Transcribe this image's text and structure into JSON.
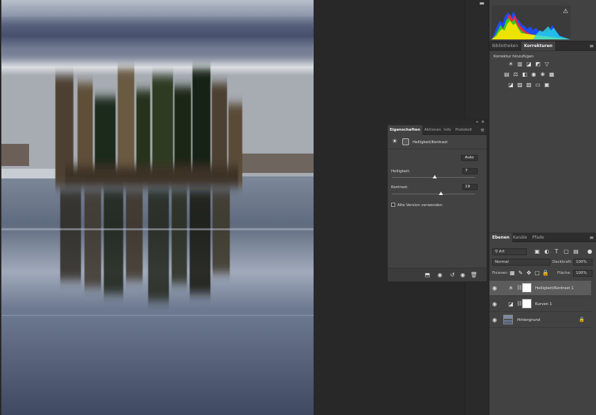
{
  "colors": {
    "accent": "#5c5c5c",
    "panel": "#424242",
    "tab_dark": "#2d2d2d"
  },
  "histogram": {
    "warning_icon": "warning-triangle-icon"
  },
  "korrekturen_panel": {
    "tabs": [
      "Bibliotheken",
      "Korrekturen"
    ],
    "active_tab": "Korrekturen",
    "title": "Korrektur hinzufügen",
    "icons": [
      [
        "brightness-icon",
        "levels-icon",
        "curves-icon",
        "exposure-icon",
        "vibrance-icon"
      ],
      [
        "hue-saturation-icon",
        "color-balance-icon",
        "black-white-icon",
        "photo-filter-icon",
        "channel-mixer-icon",
        "color-lookup-icon"
      ],
      [
        "invert-icon",
        "posterize-icon",
        "threshold-icon",
        "gradient-map-icon",
        "selective-color-icon"
      ]
    ]
  },
  "properties_panel": {
    "tabs": [
      "Eigenschaften",
      "Aktionen",
      "Info",
      "Protokoll"
    ],
    "active_tab": "Eigenschaften",
    "adjustment_name": "Helligkeit/Kontrast",
    "auto_label": "Auto",
    "brightness_label": "Helligkeit:",
    "brightness_value": "7",
    "brightness_fraction": 0.52,
    "contrast_label": "Kontrast:",
    "contrast_value": "19",
    "contrast_fraction": 0.59,
    "legacy_label": "Alte Version verwenden"
  },
  "layers_panel": {
    "tabs": [
      "Ebenen",
      "Kanäle",
      "Pfade"
    ],
    "active_tab": "Ebenen",
    "filter_value": "Art",
    "blend_mode": "Normal",
    "opacity_label": "Deckkraft:",
    "opacity_value": "100%",
    "lock_label": "Fixieren:",
    "fill_label": "Fläche:",
    "fill_value": "100%",
    "layers": [
      {
        "name": "Helligkeit/Kontrast 1",
        "selected": true
      },
      {
        "name": "Kurven 1",
        "selected": false
      },
      {
        "name": "Hintergrund",
        "selected": false
      }
    ]
  }
}
